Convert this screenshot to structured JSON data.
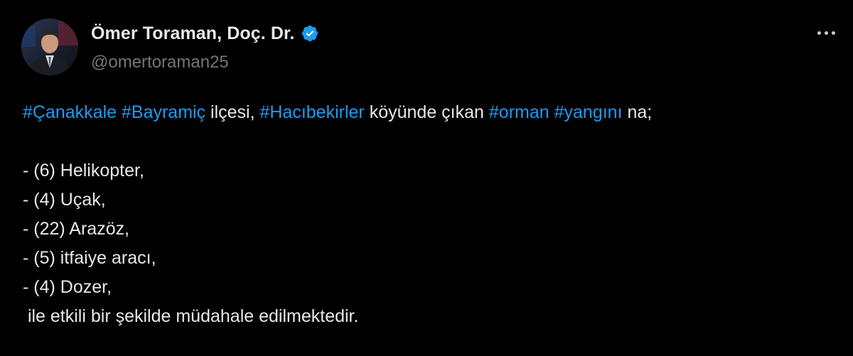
{
  "author": {
    "display_name": "Ömer Toraman, Doç. Dr.",
    "handle": "@omertoraman25",
    "verified_icon": "verified-badge-icon",
    "avatar": "profile-photo"
  },
  "menu": {
    "more_icon": "more-horizontal-icon"
  },
  "colors": {
    "background": "#000000",
    "text": "#e7e9ea",
    "handle": "#71767b",
    "hashtag": "#1d9bf0",
    "verified": "#1d9bf0"
  },
  "tweet": {
    "intro": {
      "hashtag_canakkale": "#Çanakkale",
      "space1": " ",
      "hashtag_bayramic": "#Bayramiç",
      "text_ilcesi": " ilçesi, ",
      "hashtag_hacibekirler": "#Hacıbekirler",
      "text_koyunde": " köyünde çıkan ",
      "hashtag_orman": "#orman",
      "space2": " ",
      "hashtag_yangini": "#yangını",
      "text_na": " na;"
    },
    "items": [
      "- (6) Helikopter,",
      "- (4) Uçak,",
      "- (22) Arazöz,",
      "- (5) itfaiye aracı,",
      "- (4) Dozer,"
    ],
    "closing": " ile etkili bir şekilde müdahale edilmektedir."
  }
}
